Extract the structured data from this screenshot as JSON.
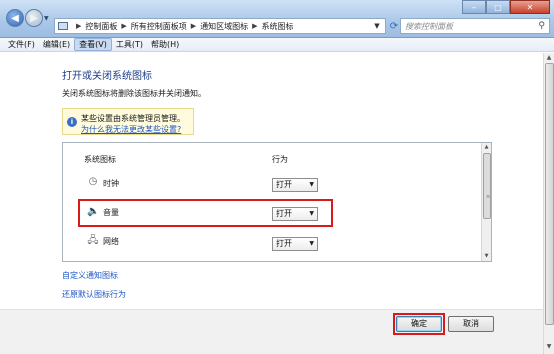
{
  "address": {
    "breadcrumbs": [
      "控制面板",
      "所有控制面板项",
      "通知区域图标",
      "系统图标"
    ],
    "search_placeholder": "搜索控制面板"
  },
  "menubar": {
    "items": [
      "文件(F)",
      "编辑(E)",
      "查看(V)",
      "工具(T)",
      "帮助(H)"
    ],
    "active_index": 2
  },
  "page": {
    "title": "打开或关闭系统图标",
    "description": "关闭系统图标将删除该图标并关闭通知。"
  },
  "infobox": {
    "line1": "某些设置由系统管理员管理。",
    "link": "为什么我无法更改某些设置?"
  },
  "table": {
    "col_icon": "系统图标",
    "col_behavior": "行为",
    "rows": [
      {
        "icon": "clock-icon",
        "label": "时钟",
        "value": "打开"
      },
      {
        "icon": "volume-icon",
        "label": "音量",
        "value": "打开",
        "highlighted": true
      },
      {
        "icon": "network-icon",
        "label": "网络",
        "value": "打开"
      }
    ]
  },
  "links": {
    "customize": "自定义通知图标",
    "restore": "还原默认图标行为"
  },
  "buttons": {
    "ok": "确定",
    "cancel": "取消"
  },
  "colors": {
    "title": "#1f3d8a",
    "link": "#1c55c7",
    "highlight": "#d81a1a"
  }
}
